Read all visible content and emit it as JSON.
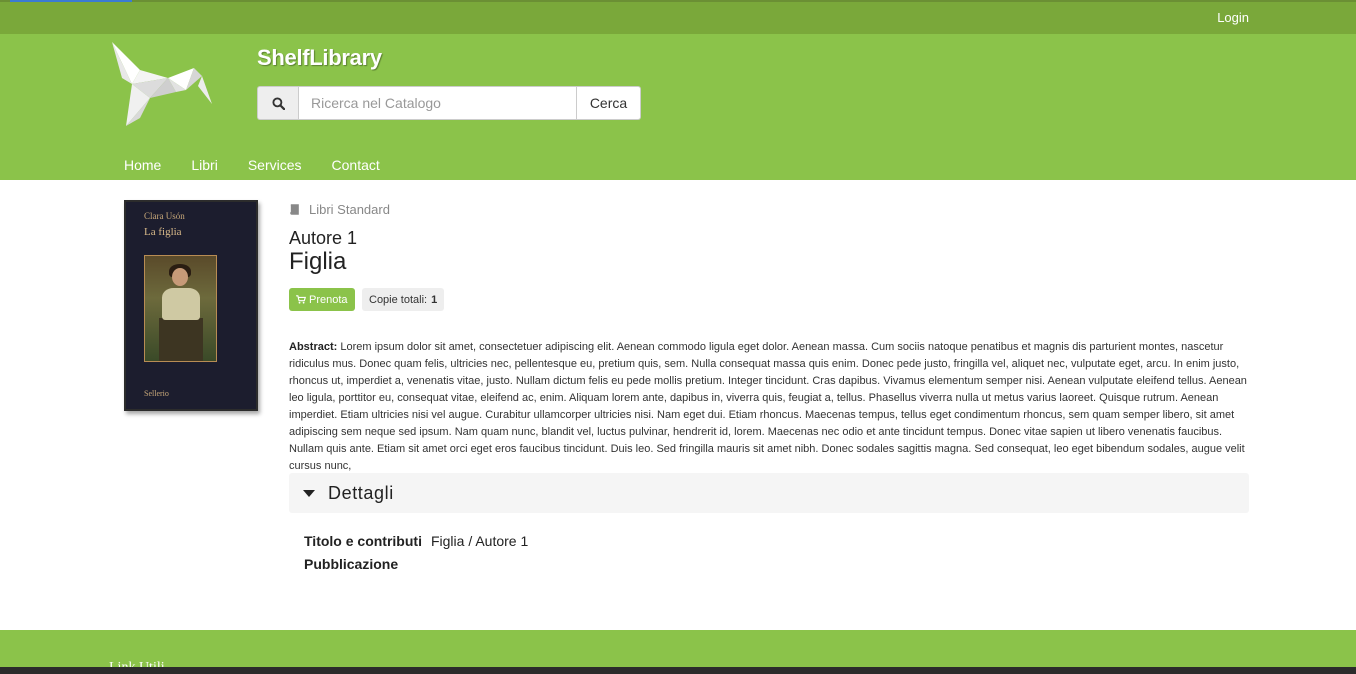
{
  "topbar": {
    "login_label": "Login"
  },
  "header": {
    "site_title": "ShelfLibrary",
    "search": {
      "placeholder": "Ricerca nel Catalogo",
      "value": "",
      "button_label": "Cerca"
    },
    "nav": [
      {
        "label": "Home"
      },
      {
        "label": "Libri"
      },
      {
        "label": "Services"
      },
      {
        "label": "Contact"
      }
    ]
  },
  "book": {
    "cover": {
      "author": "Clara Usón",
      "title": "La figlia",
      "publisher": "Sellerio"
    },
    "category": "Libri Standard",
    "author": "Autore 1",
    "title": "Figlia",
    "reserve_label": "Prenota",
    "copies_label": "Copie totali:",
    "copies_count": "1",
    "abstract_label": "Abstract:",
    "abstract_text": "Lorem ipsum dolor sit amet, consectetuer adipiscing elit. Aenean commodo ligula eget dolor. Aenean massa. Cum sociis natoque penatibus et magnis dis parturient montes, nascetur ridiculus mus. Donec quam felis, ultricies nec, pellentesque eu, pretium quis, sem. Nulla consequat massa quis enim. Donec pede justo, fringilla vel, aliquet nec, vulputate eget, arcu. In enim justo, rhoncus ut, imperdiet a, venenatis vitae, justo. Nullam dictum felis eu pede mollis pretium. Integer tincidunt. Cras dapibus. Vivamus elementum semper nisi. Aenean vulputate eleifend tellus. Aenean leo ligula, porttitor eu, consequat vitae, eleifend ac, enim. Aliquam lorem ante, dapibus in, viverra quis, feugiat a, tellus. Phasellus viverra nulla ut metus varius laoreet. Quisque rutrum. Aenean imperdiet. Etiam ultricies nisi vel augue. Curabitur ullamcorper ultricies nisi. Nam eget dui. Etiam rhoncus. Maecenas tempus, tellus eget condimentum rhoncus, sem quam semper libero, sit amet adipiscing sem neque sed ipsum. Nam quam nunc, blandit vel, luctus pulvinar, hendrerit id, lorem. Maecenas nec odio et ante tincidunt tempus. Donec vitae sapien ut libero venenatis faucibus. Nullam quis ante. Etiam sit amet orci eget eros faucibus tincidunt. Duis leo. Sed fringilla mauris sit amet nibh. Donec sodales sagittis magna. Sed consequat, leo eget bibendum sodales, augue velit cursus nunc,"
  },
  "details": {
    "header_label": "Dettagli",
    "rows": [
      {
        "label": "Titolo e contributi",
        "value": "Figlia / Autore 1"
      },
      {
        "label": "Pubblicazione",
        "value": ""
      }
    ]
  },
  "footer": {
    "title": "Link Utili"
  },
  "colors": {
    "brand_green": "#8bc34a",
    "topbar_green": "#7aa83a",
    "footer_strip": "#2b2b2b"
  },
  "icons": {
    "search": "search-icon",
    "category": "book-icon",
    "reserve": "cart-icon",
    "details_toggle": "caret-down-icon"
  }
}
